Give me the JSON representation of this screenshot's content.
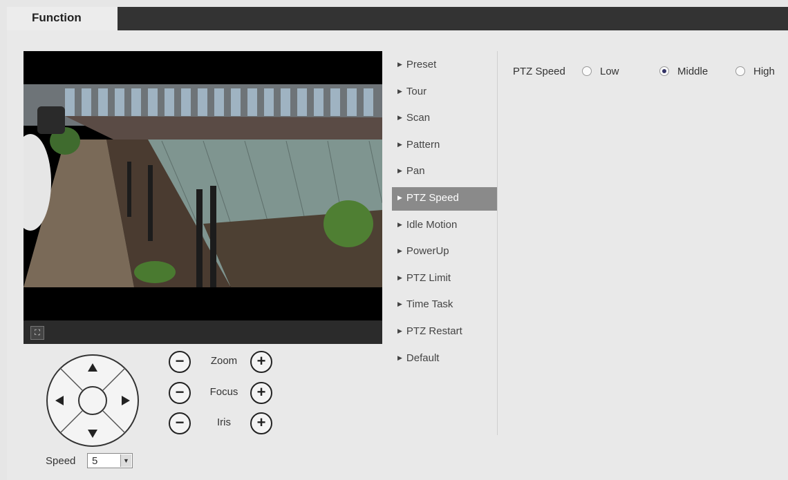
{
  "tabs": {
    "active_label": "Function"
  },
  "video": {
    "fullscreen_icon": "fullscreen-icon"
  },
  "dpad": {
    "icons": [
      "arrow-up-icon",
      "arrow-down-icon",
      "arrow-left-icon",
      "arrow-right-icon",
      "center-icon"
    ]
  },
  "lens": {
    "zoom_label": "Zoom",
    "focus_label": "Focus",
    "iris_label": "Iris",
    "minus": "−",
    "plus": "+"
  },
  "speed": {
    "label": "Speed",
    "value": "5"
  },
  "menu": {
    "items": [
      {
        "label": "Preset"
      },
      {
        "label": "Tour"
      },
      {
        "label": "Scan"
      },
      {
        "label": "Pattern"
      },
      {
        "label": "Pan"
      },
      {
        "label": "PTZ Speed",
        "active": true
      },
      {
        "label": "Idle Motion"
      },
      {
        "label": "PowerUp"
      },
      {
        "label": "PTZ Limit"
      },
      {
        "label": "Time Task"
      },
      {
        "label": "PTZ Restart"
      },
      {
        "label": "Default"
      }
    ]
  },
  "ptz_speed": {
    "title": "PTZ Speed",
    "options": [
      "Low",
      "Middle",
      "High"
    ],
    "selected": "Middle"
  },
  "colors": {
    "tab_bar": "#333333",
    "active_menu": "#8a8a8a",
    "background": "#e6e6e6"
  }
}
